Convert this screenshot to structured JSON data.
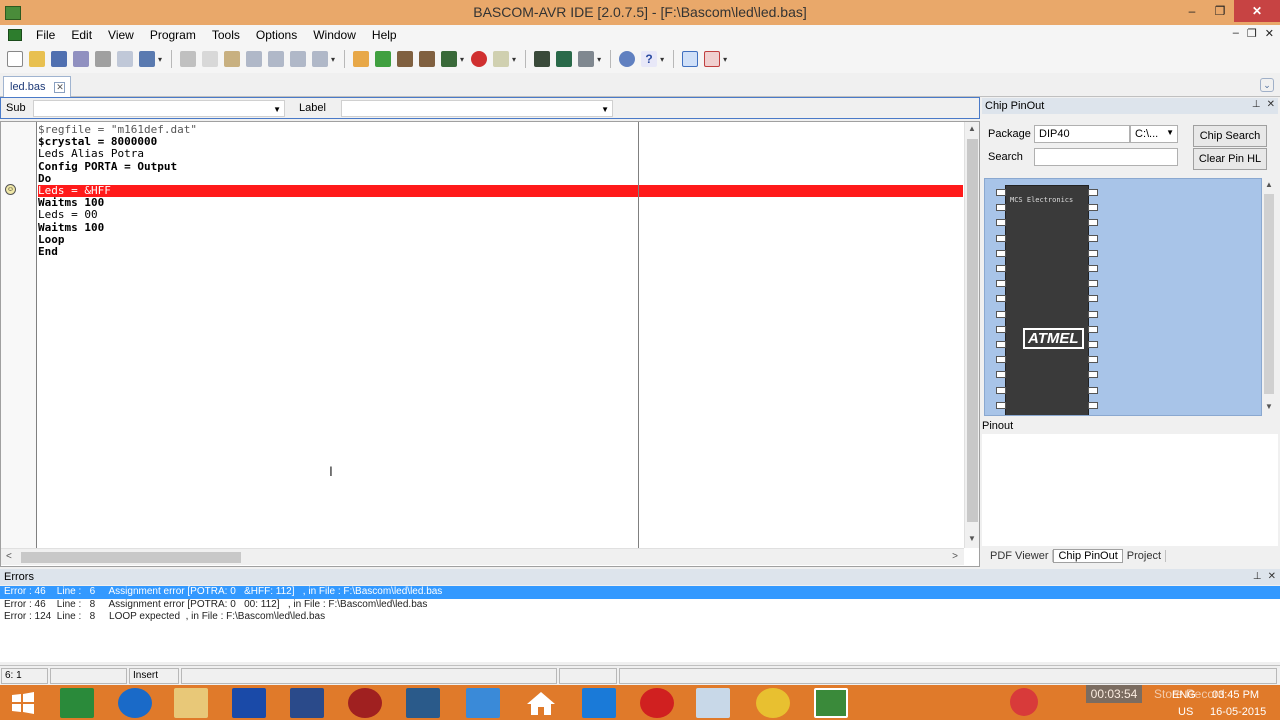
{
  "window": {
    "title": "BASCOM-AVR IDE [2.0.7.5] - [F:\\Bascom\\led\\led.bas]",
    "minimize": "–",
    "restore": "❐",
    "close": "✕"
  },
  "menu": {
    "items": [
      "File",
      "Edit",
      "View",
      "Program",
      "Tools",
      "Options",
      "Window",
      "Help"
    ],
    "mdi_minimize": "–",
    "mdi_restore": "❐",
    "mdi_close": "✕"
  },
  "tabs": {
    "active": "led.bas",
    "close": "✕"
  },
  "subbar": {
    "sub_label": "Sub",
    "label_label": "Label"
  },
  "editor": {
    "lines": [
      {
        "text": "$regfile = \"m161def.dat\"",
        "style": "str"
      },
      {
        "text": "$crystal = 8000000",
        "style": "kw"
      },
      {
        "text": "Leds Alias Potra",
        "style": "plain"
      },
      {
        "text": "Config PORTA = Output",
        "style": "kw"
      },
      {
        "text": "Do",
        "style": "kw"
      },
      {
        "text": "Leds = &HFF",
        "style": "error"
      },
      {
        "text": "Waitms 100",
        "style": "kw"
      },
      {
        "text": "Leds = 00",
        "style": "plain"
      },
      {
        "text": "Waitms 100",
        "style": "kw"
      },
      {
        "text": "Loop",
        "style": "kw"
      },
      {
        "text": "End",
        "style": "kw"
      }
    ],
    "error_line_color": "#ff1a1a"
  },
  "chip_panel": {
    "title": "Chip PinOut",
    "package_label": "Package",
    "package_value": "DIP40",
    "package_drive": "C:\\...",
    "search_label": "Search",
    "search_value": "",
    "chip_search_button": "Chip Search",
    "clear_pin_button": "Clear Pin HL",
    "chip_brand": "MCS Electronics",
    "chip_logo": "ATMEL",
    "pinout_label": "Pinout",
    "tabs": [
      "PDF Viewer",
      "Chip PinOut",
      "Project"
    ],
    "active_tab": "Chip PinOut"
  },
  "errors": {
    "title": "Errors",
    "rows": [
      "Error : 46    Line :   6     Assignment error [POTRA: 0   &HFF: 112]   , in File : F:\\Bascom\\led\\led.bas",
      "Error : 46    Line :   8     Assignment error [POTRA: 0   00: 112]   , in File : F:\\Bascom\\led\\led.bas",
      "Error : 124  Line :   8     LOOP expected  , in File : F:\\Bascom\\led\\led.bas"
    ],
    "selected_index": 0
  },
  "status": {
    "position": "6: 1",
    "mode": "Insert"
  },
  "taskbar": {
    "recording_time": "00:03:54",
    "watermark": "Store Record",
    "lang": "ENG",
    "region": "US",
    "time": "03:45 PM",
    "date": "16-05-2015",
    "accent": "#e07a2a"
  }
}
